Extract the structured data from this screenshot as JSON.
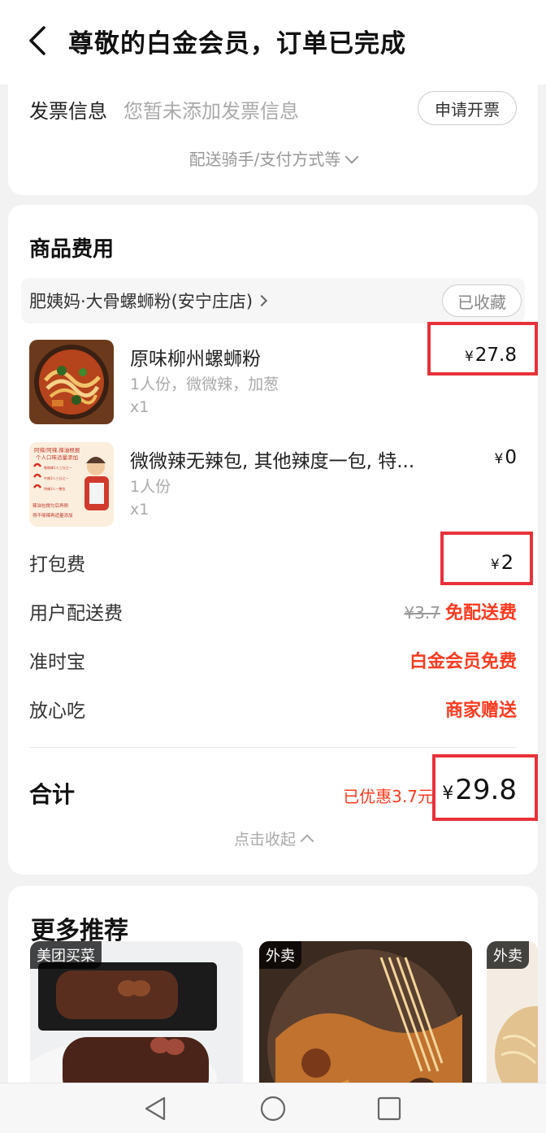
{
  "header": {
    "title": "尊敬的白金会员，订单已完成"
  },
  "invoice": {
    "label": "发票信息",
    "value": "您暂未添加发票信息",
    "button": "申请开票",
    "expand_text": "配送骑手/支付方式等"
  },
  "goods": {
    "section_title": "商品费用",
    "store_name": "肥姨妈·大骨螺蛳粉(安宁庄店)",
    "favorite_label": "已收藏",
    "items": [
      {
        "name": "原味柳州螺蛳粉",
        "spec": "1人份，微微辣，加葱",
        "qty": "x1",
        "currency": "¥",
        "price": "27.8"
      },
      {
        "name": "微微辣无辣包, 其他辣度一包, 特...",
        "spec": "1人份",
        "qty": "x1",
        "currency": "¥",
        "price": "0"
      }
    ],
    "thumb2_text": [
      "阿辣/阿辣,辣油根据",
      "个人口味适量添加",
      "微微辣1人三分之一",
      "中辣3人三分之一",
      "特辣3人一整包",
      "辣油包搅匀后再倒",
      "得不够辣再适量添加"
    ],
    "fees": {
      "packing": {
        "label": "打包费",
        "currency": "¥",
        "value": "2"
      },
      "delivery": {
        "label": "用户配送费",
        "original": "¥3.7",
        "value": "免配送费"
      },
      "ontime": {
        "label": "准时宝",
        "value": "白金会员免费"
      },
      "safe": {
        "label": "放心吃",
        "value": "商家赠送"
      }
    },
    "total": {
      "label": "合计",
      "discount": "已优惠3.7元",
      "currency": "¥",
      "value": "29.8"
    },
    "collapse_text": "点击收起"
  },
  "recommend": {
    "title": "更多推荐",
    "tiles": [
      {
        "tag": "美团买菜"
      },
      {
        "tag": "外卖"
      },
      {
        "tag": "外卖"
      }
    ]
  },
  "colors": {
    "accent_red": "#ff3a1f",
    "highlight_box": "#e8323a",
    "background": "#f2f2f2"
  }
}
